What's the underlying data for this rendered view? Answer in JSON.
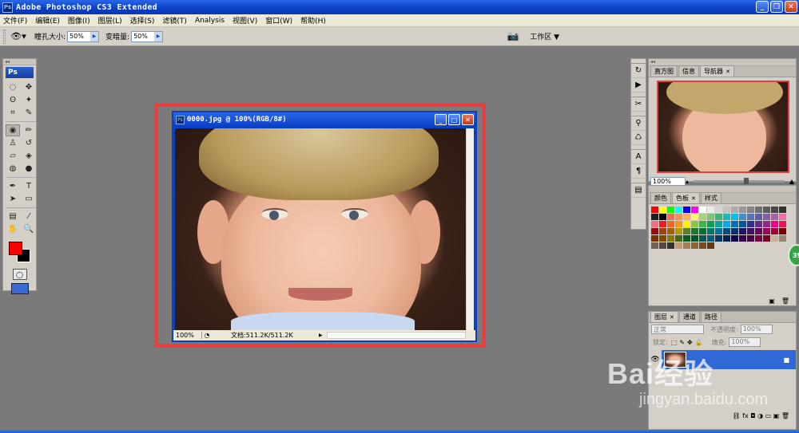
{
  "window": {
    "title": "Adobe Photoshop CS3 Extended",
    "icon": "Ps",
    "controls": [
      "_",
      "❐",
      "✕"
    ]
  },
  "menu": [
    "文件(F)",
    "编辑(E)",
    "图像(I)",
    "图层(L)",
    "选择(S)",
    "滤镜(T)",
    "Analysis",
    "视图(V)",
    "窗口(W)",
    "帮助(H)"
  ],
  "options": {
    "pupil_label": "瞳孔大小:",
    "pupil_value": "50%",
    "darken_label": "变暗量:",
    "darken_value": "50%",
    "workspace_label": "工作区 ▼"
  },
  "toolbox": {
    "logo": "Ps",
    "collapse": "◂◂",
    "fg_color": "#ff0000",
    "bg_color": "#000000"
  },
  "document": {
    "title": "0000.jpg @ 100%(RGB/8#)",
    "zoom": "100%",
    "doc_info": "文档:511.2K/511.2K"
  },
  "navigator_panel": {
    "tabs": [
      "直方图",
      "信息",
      "导航器"
    ],
    "active_tab": "导航器",
    "zoom": "100%"
  },
  "swatches_panel": {
    "tabs": [
      "颜色",
      "色板",
      "样式"
    ],
    "active_tab": "色板",
    "colors": [
      "#ff0000",
      "#ffff00",
      "#00ff00",
      "#00ffff",
      "#0000ff",
      "#ff00ff",
      "#ffffff",
      "#ebebeb",
      "#d6d6d6",
      "#c2c2c2",
      "#adadad",
      "#999999",
      "#858585",
      "#707070",
      "#5c5c5c",
      "#474747",
      "#333333",
      "#1f1f1f",
      "#000000",
      "#f26c4f",
      "#f68e55",
      "#fbaf5c",
      "#fff467",
      "#acd372",
      "#7cc576",
      "#3bb878",
      "#1abbb4",
      "#00bff3",
      "#438ccb",
      "#5574b9",
      "#605ca8",
      "#855fa8",
      "#a763a8",
      "#f06ea9",
      "#f26d7d",
      "#ed1c24",
      "#f26522",
      "#f7941d",
      "#fff200",
      "#8dc63f",
      "#39b54a",
      "#00a651",
      "#00a99d",
      "#00aeef",
      "#0072bc",
      "#0054a6",
      "#2e3192",
      "#662d91",
      "#92278f",
      "#ec008c",
      "#ed145b",
      "#9e0b0f",
      "#a0410d",
      "#a36209",
      "#aba000",
      "#598527",
      "#1a7b30",
      "#007236",
      "#00746b",
      "#0076a3",
      "#004b80",
      "#003471",
      "#1b1464",
      "#440e62",
      "#630460",
      "#9e005d",
      "#9e0039",
      "#790000",
      "#7b2e00",
      "#7d4900",
      "#827b00",
      "#406618",
      "#005e20",
      "#005826",
      "#005952",
      "#005b7f",
      "#003663",
      "#002157",
      "#0d004c",
      "#32004b",
      "#4b0049",
      "#7b0046",
      "#7a0026",
      "#c7b299",
      "#998675",
      "#736357",
      "#534741",
      "#37302d",
      "#c69c6d",
      "#a67c52",
      "#8c6239",
      "#754c24",
      "#603913"
    ]
  },
  "layers_panel": {
    "tabs": [
      "图层",
      "通道",
      "路径"
    ],
    "active_tab": "图层",
    "blend_mode": "正常",
    "opacity_label": "不透明度:",
    "opacity_value": "100%",
    "lock_label": "锁定:",
    "lock_icons": "⬚✎✥🔒",
    "fill_label": "填充:",
    "fill_value": "100%",
    "layer_name": "",
    "footer_icons": "⛓ fx ◘ ◑ ▭ ▣ 🗑"
  },
  "badge_text": "39",
  "watermark": {
    "logo": "Bai经验",
    "url": "jingyan.baidu.com"
  }
}
